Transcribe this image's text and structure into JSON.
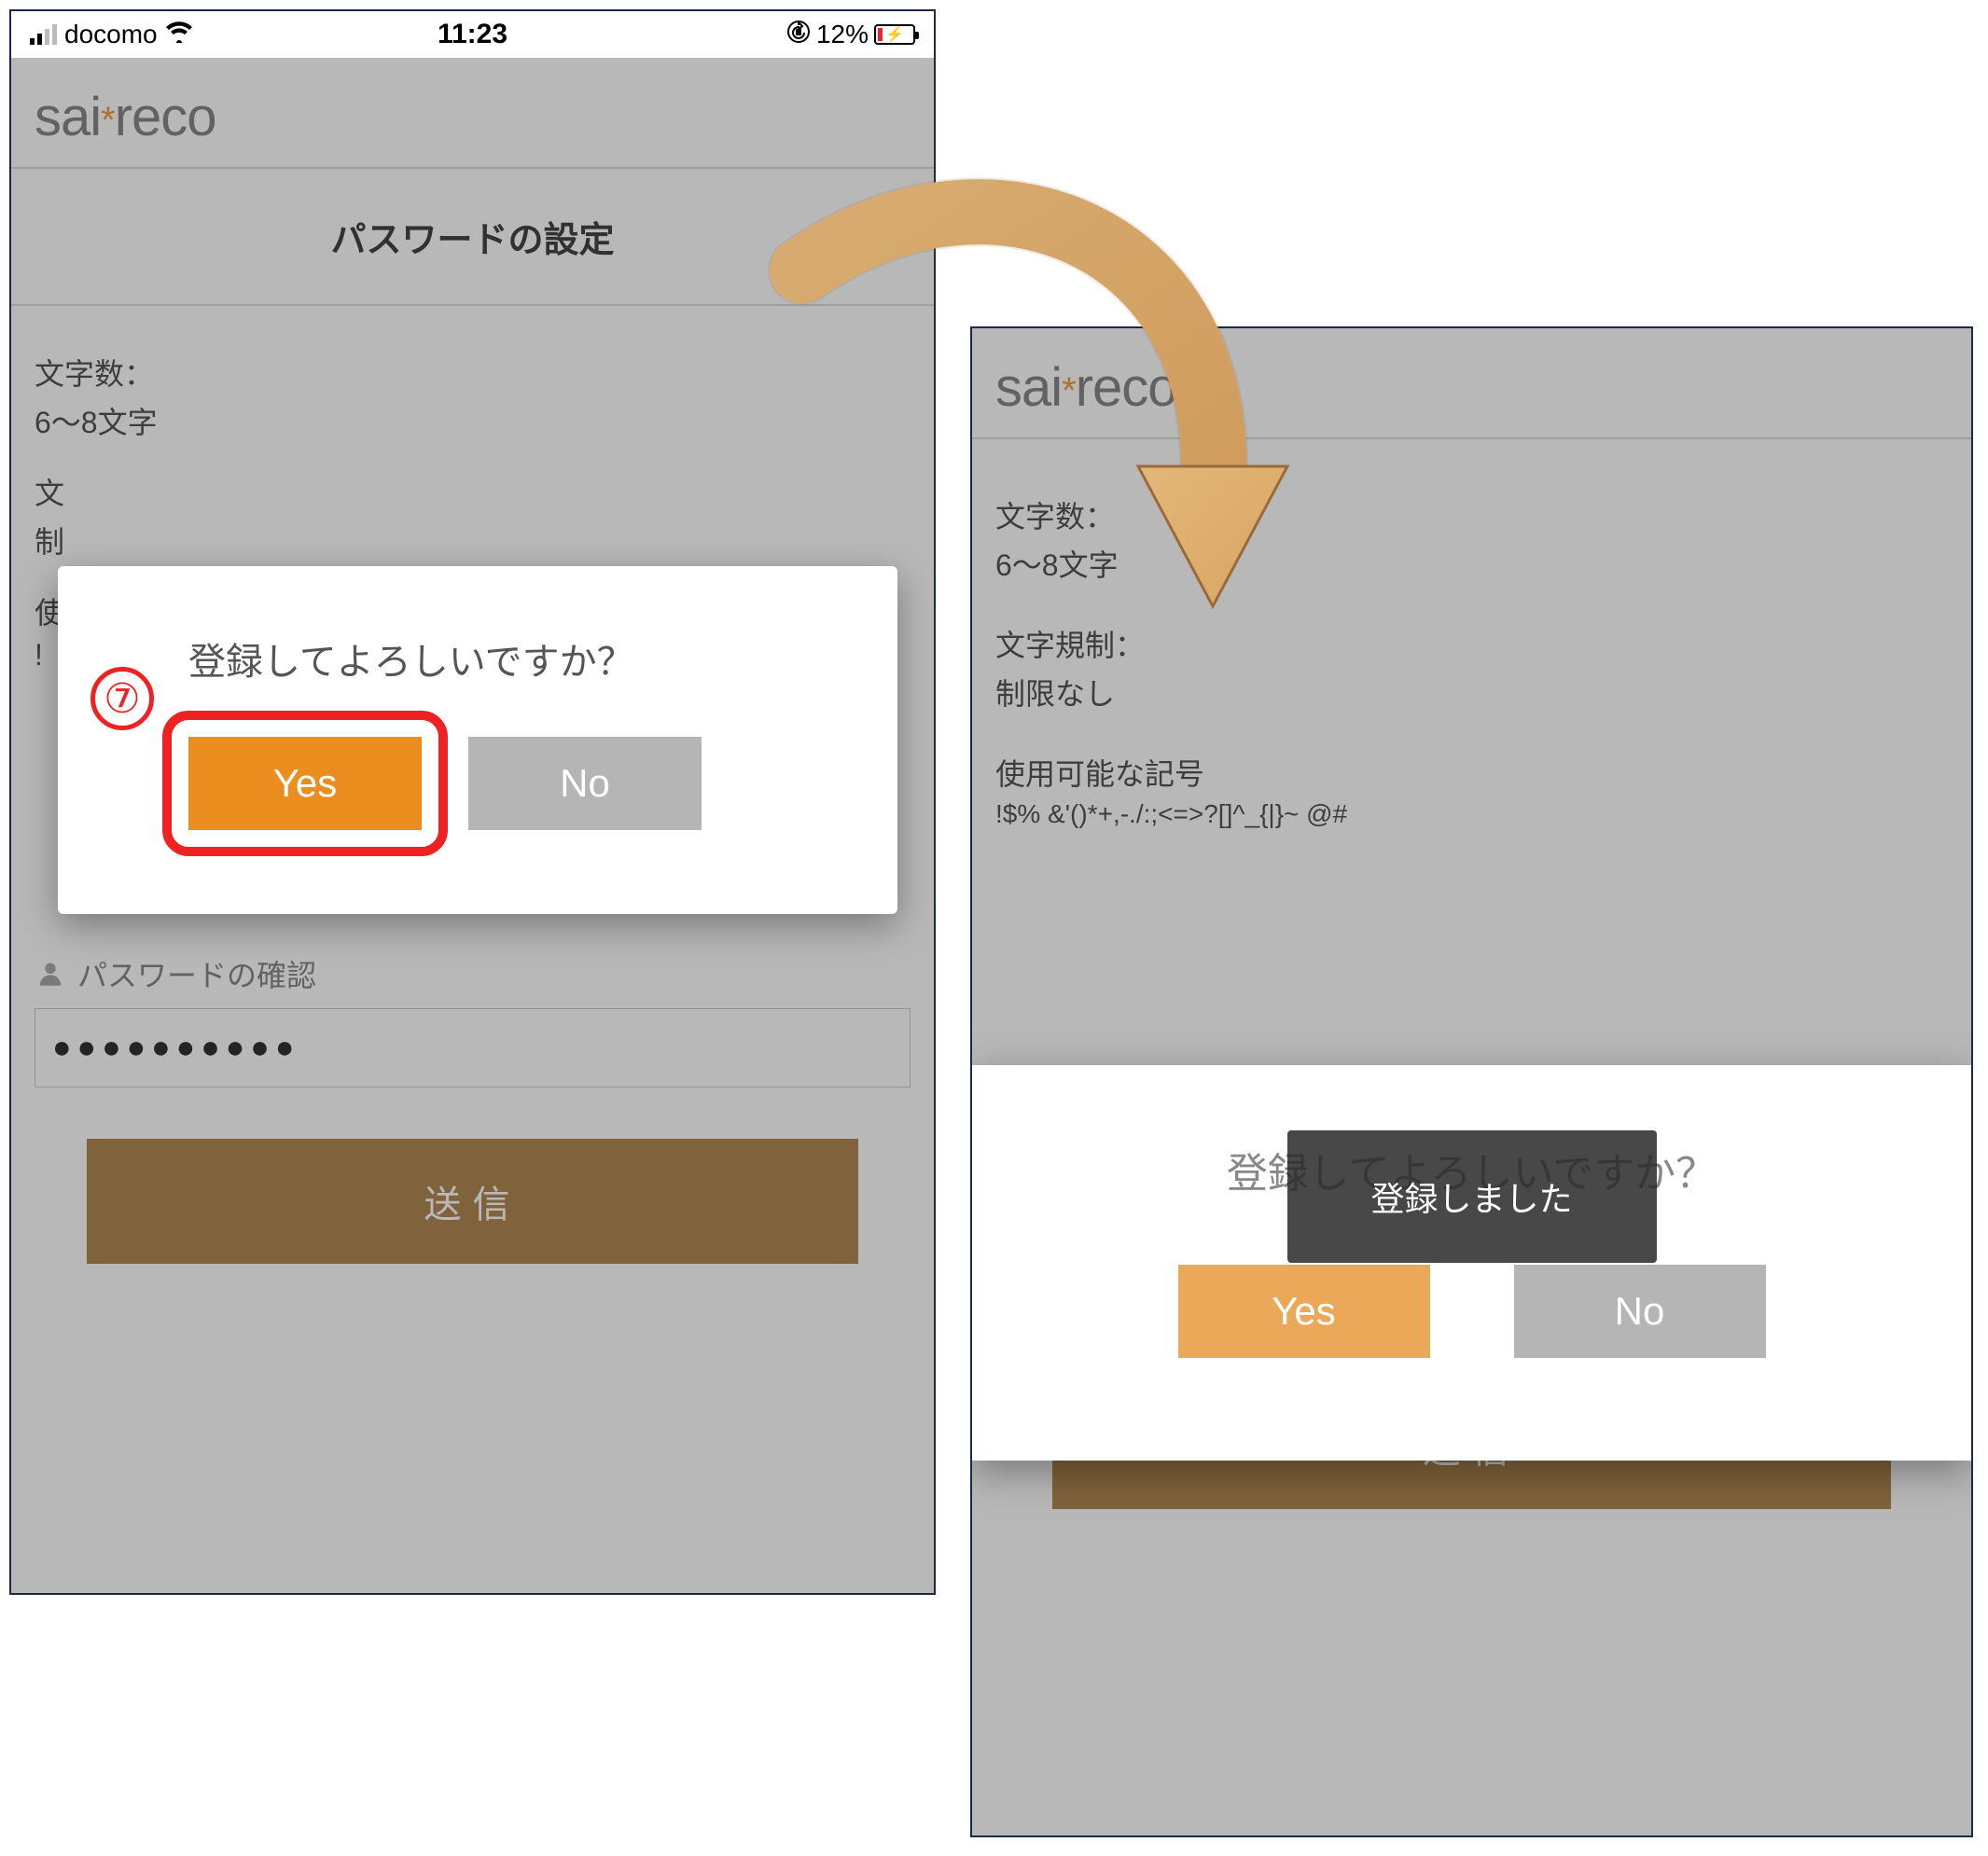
{
  "status_bar": {
    "carrier": "docomo",
    "time": "11:23",
    "battery_percent": "12%"
  },
  "logo": {
    "part1": "sai",
    "star": "*",
    "part2": "reco"
  },
  "page_title": "パスワードの設定",
  "rules": {
    "count_label": "文字数：",
    "count_value": "6～8文字",
    "type_label": "文字規制：",
    "type_value": "制限なし",
    "symbols_label": "使用可能な記号",
    "symbols_value": "!$% &'()*+,-./:;<=>?[]^_{|}~ @#"
  },
  "confirm_field_label": "パスワードの確認",
  "confirm_value_mask": "●●●●●●●●●●",
  "submit_label": "送信",
  "modal_left": {
    "title": "登録してよろしいですか？",
    "yes": "Yes",
    "no": "No",
    "step_number": "⑦"
  },
  "modal_right": {
    "title_behind": "登録してよろしいですか？",
    "yes": "Yes",
    "no": "No"
  },
  "toast": "登録しました"
}
